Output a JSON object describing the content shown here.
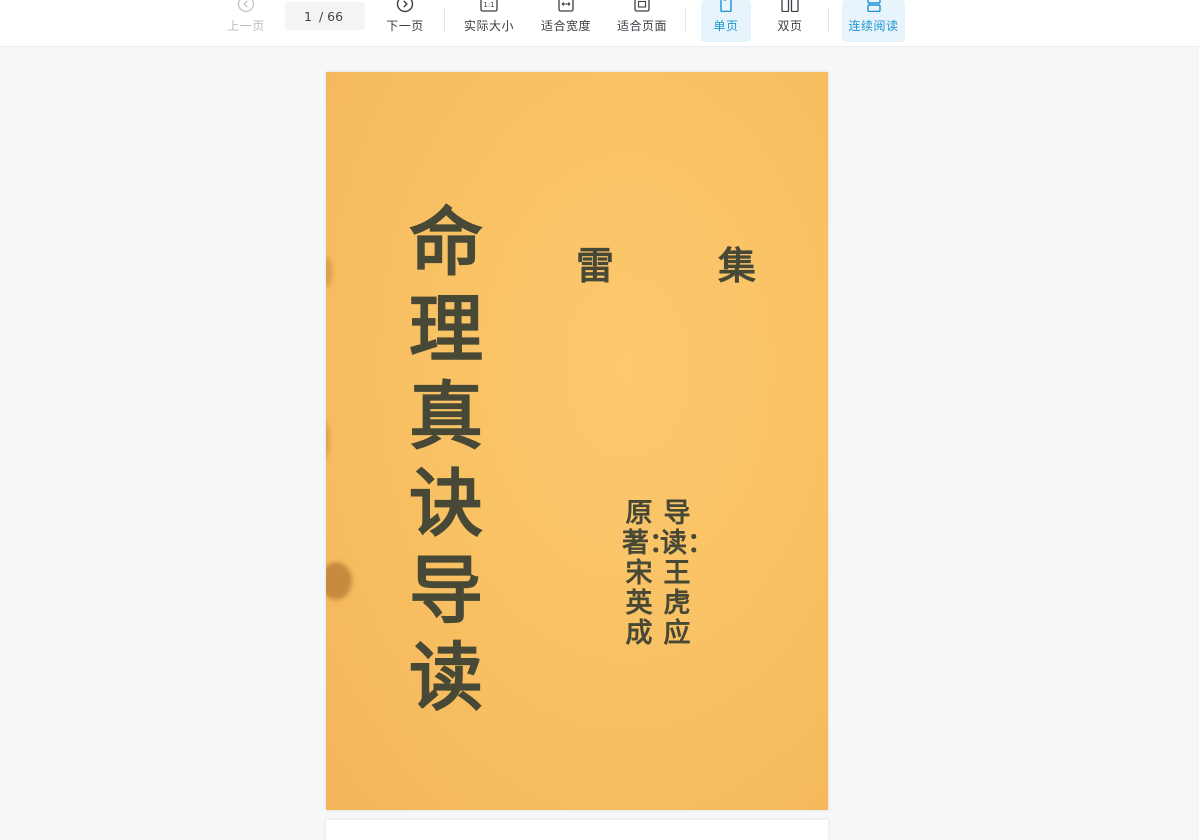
{
  "toolbar": {
    "prev_label": "上一页",
    "page_current": "1",
    "page_total": "/ 66",
    "next_label": "下一页",
    "actual_size_label": "实际大小",
    "fit_width_label": "适合宽度",
    "fit_page_label": "适合页面",
    "single_page_label": "单页",
    "double_page_label": "双页",
    "continuous_label": "连续阅读",
    "active_color": "#1b95d3"
  },
  "document": {
    "title": "命理真诀导读",
    "series_left": "雷",
    "series_right": "集",
    "credit_original": "原著：宋英成",
    "credit_guide": "导读：王虎应",
    "cover_color": "#f8c062",
    "ink_color": "#474836"
  }
}
